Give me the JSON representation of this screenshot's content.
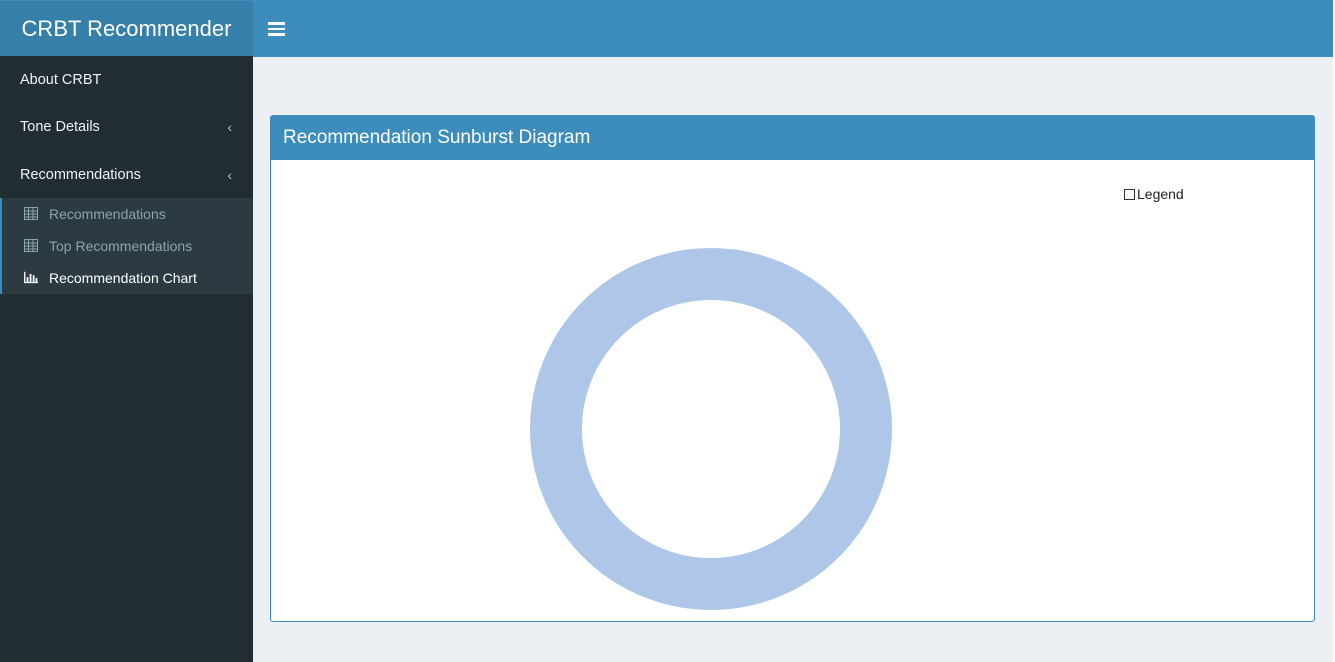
{
  "app": {
    "title": "CRBT Recommender"
  },
  "sidebar": {
    "items": [
      {
        "label": "About CRBT"
      },
      {
        "label": "Tone Details"
      },
      {
        "label": "Recommendations"
      }
    ],
    "subitems": [
      {
        "label": "Recommendations",
        "icon": "table-icon"
      },
      {
        "label": "Top Recommendations",
        "icon": "table-icon"
      },
      {
        "label": "Recommendation Chart",
        "icon": "bar-chart-icon",
        "active": true
      }
    ]
  },
  "main": {
    "box_title": "Recommendation Sunburst Diagram",
    "legend_label": "Legend",
    "legend_checked": false
  },
  "colors": {
    "header": "#3c8dbc",
    "logo": "#367fa9",
    "sidebar": "#222d32",
    "submenu": "#2c3b41",
    "content_bg": "#ecf0f5",
    "ring": "#aec7e8"
  }
}
